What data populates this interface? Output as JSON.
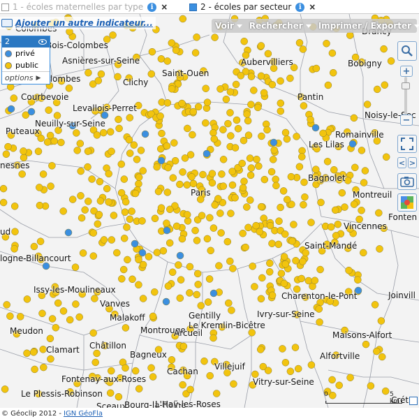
{
  "tabs": [
    {
      "label": "1 - écoles maternelles par type",
      "active": false
    },
    {
      "label": "2 - écoles par secteur",
      "active": true
    }
  ],
  "tab_info_glyph": "i",
  "tab_close_glyph": "×",
  "add_indicator": "Ajouter un autre indicateur...",
  "legend": {
    "id": "2",
    "items": [
      {
        "label": "privé",
        "color": "#3b8fe0"
      },
      {
        "label": "public",
        "color": "#f2c40e"
      }
    ],
    "options_label": "options"
  },
  "toolbar": {
    "voir": "Voir",
    "rechercher": "Rechercher",
    "imprimer": "Imprimer / Exporter"
  },
  "controls": {
    "zoom_in": "+",
    "zoom_out": "−",
    "prev": "<",
    "next": ">"
  },
  "colors": {
    "private": "#3b8fe0",
    "public": "#f2c40e",
    "border_lines": "#9a9ea8",
    "map_bg": "#f3f3f3"
  },
  "cities": {
    "colombes": "Colombes",
    "bois_colombes": "Bois-Colombes",
    "asnieres": "Asnières-sur-Seine",
    "saint_ouen": "Saint-Ouen",
    "aubervilliers": "Aubervilliers",
    "bobigny": "Bobigny",
    "drancy": "Drancy",
    "la_garenne": "Colombes",
    "clichy": "Clichy",
    "pantin": "Pantin",
    "courbevoie": "Courbevoie",
    "levallois": "Levallois-Perret",
    "noisy": "Noisy-le-Sec",
    "neuilly": "Neuilly-sur-Seine",
    "romainville": "Romainville",
    "puteaux": "Puteaux",
    "les_lilas": "Les Lilas",
    "nanterre": "nesnes",
    "paris": "Paris",
    "bagnolet": "Bagnolet",
    "montreuil": "Montreuil",
    "fontenay_bois": "Fonten",
    "vincennes": "Vincennes",
    "saint_cloud": "ud",
    "saint_mande": "Saint-Mandé",
    "boulogne": "logne-Billancourt",
    "issy": "Issy-les-Moulineaux",
    "charenton": "Charenton-le-Pont",
    "joinville": "Joinvill",
    "vanves": "Vanves",
    "malakoff": "Malakoff",
    "gentilly": "Gentilly",
    "kremlin": "Le Kremlin-Bicêtre",
    "ivry": "Ivry-sur-Seine",
    "meudon": "Meudon",
    "montrouge": "Montrouge",
    "arcueil": "Arcueil",
    "maisons_alfort": "Maisons-Alfort",
    "chatillon": "Châtillon",
    "clamart": "Clamart",
    "bagneux": "Bagneux",
    "alfortville": "Alfortville",
    "villejuif": "Villejuif",
    "cachan": "Cachan",
    "fontenay_roses": "Fontenay-aux-Roses",
    "vitry": "Vitry-sur-Seine",
    "plessis": "Le Plessis-Robinson",
    "sceaux": "Sceaux",
    "bourg_la_reine": "Bourg-la-Reine",
    "hay_les_roses": "L'Haÿ-les-Roses",
    "creteil": "Crét"
  },
  "scale": {
    "zero": "0",
    "max": "5 km"
  },
  "footer": {
    "copyright": "© Géoclip 2012 -",
    "link": "IGN GéoFla"
  }
}
